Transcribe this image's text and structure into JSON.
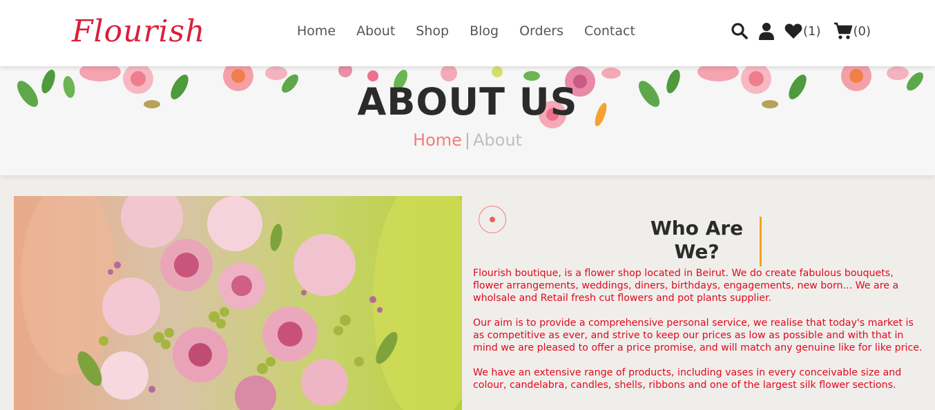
{
  "brand": {
    "logo_text": "Flourish"
  },
  "nav": {
    "links": [
      "Home",
      "About",
      "Shop",
      "Blog",
      "Orders",
      "Contact"
    ],
    "wishlist_count": "(1)",
    "cart_count": "(0)",
    "icons": [
      "search-icon",
      "user-icon",
      "heart-icon",
      "cart-icon"
    ]
  },
  "hero": {
    "title": "ABOUT US",
    "breadcrumb_home": "Home",
    "breadcrumb_separator": "|",
    "breadcrumb_current": "About"
  },
  "about": {
    "heading": "Who Are We?",
    "paragraphs": [
      "Flourish boutique, is a flower shop located in Beirut. We do create fabulous bouquets, flower arrangements, weddings, diners, birthdays, engagements, new born... We are a wholsale and Retail fresh cut flowers and pot plants supplier.",
      "Our aim is to provide a comprehensive personal service, we realise that today's market is as competitive as ever, and strive to keep our prices as low as possible and with that in mind we are pleased to offer a price promise, and will match any genuine like for like price.",
      "We have an extensive range of products, including vases in every conceivable size and colour, candelabra, candles, shells, ribbons and one of the largest silk flower sections."
    ]
  },
  "colors": {
    "accent_pink": "#f47c7c",
    "text_red": "#e0091c",
    "bar_orange": "#f4a21a",
    "logo_red": "#d9203b"
  }
}
